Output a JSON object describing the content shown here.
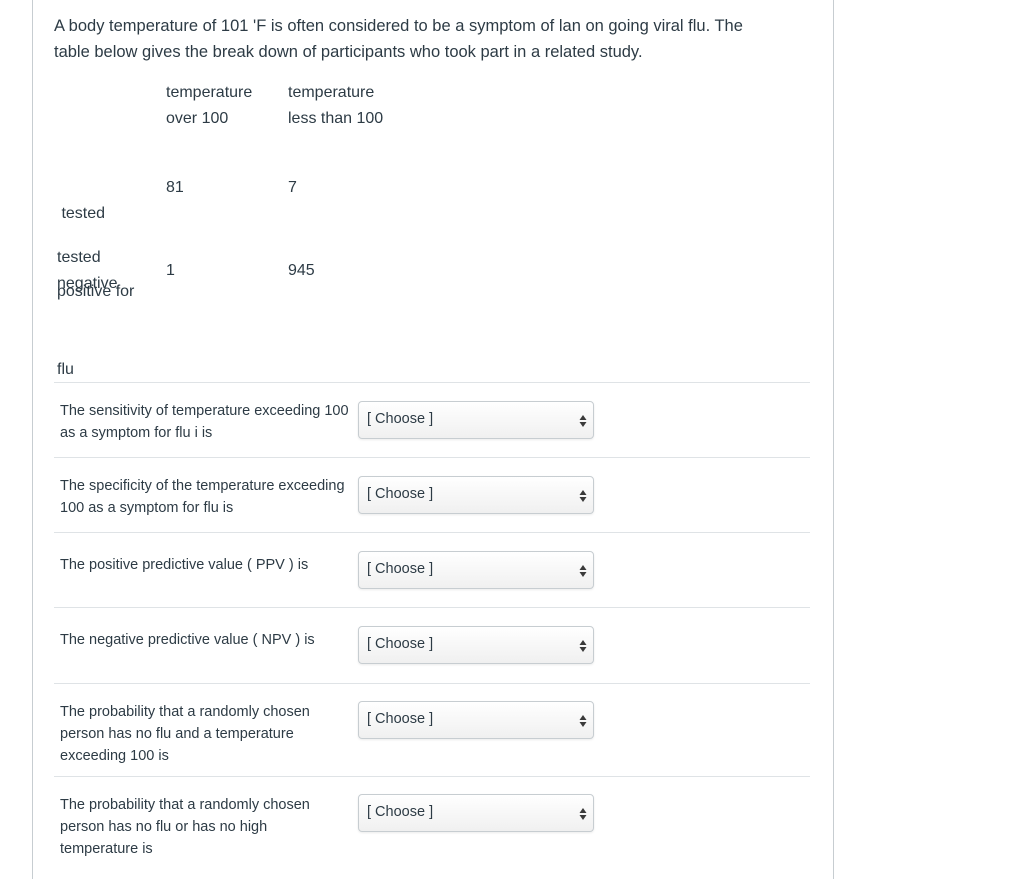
{
  "intro": {
    "line1": "A body temperature of 101 'F is often considered to be a symptom of lan on going viral flu.  The",
    "line2": "table below gives the break down of participants who took part in a related study."
  },
  "table": {
    "col_headers": [
      {
        "line1": "temperature",
        "line2": "over 100"
      },
      {
        "line1": "temperature",
        "line2": "less than 100"
      }
    ],
    "rows": [
      {
        "label_lines": [
          " tested",
          "positive for",
          "flu"
        ],
        "values": [
          "81",
          "7"
        ]
      },
      {
        "label_lines": [
          "tested",
          "negative"
        ],
        "values": [
          "1",
          "945"
        ]
      }
    ]
  },
  "questions": [
    {
      "text": "The sensitivity of temperature exceeding 100 as a symptom for flu i is",
      "select": "[ Choose ]"
    },
    {
      "text": "The specificity of the temperature exceeding 100 as a symptom for flu is",
      "select": "[ Choose ]"
    },
    {
      "text": "The positive predictive value ( PPV ) is",
      "select": "[ Choose ]"
    },
    {
      "text": "The negative predictive value ( NPV ) is",
      "select": "[ Choose ]"
    },
    {
      "text": "The probability that a randomly chosen person has no flu and a temperature exceeding 100 is",
      "select": "[ Choose ]"
    },
    {
      "text": "The probability that a randomly chosen person has no flu or has no high temperature is",
      "select": "[ Choose ]"
    }
  ],
  "icons": {
    "select_arrow": "up-down-arrows-icon"
  }
}
